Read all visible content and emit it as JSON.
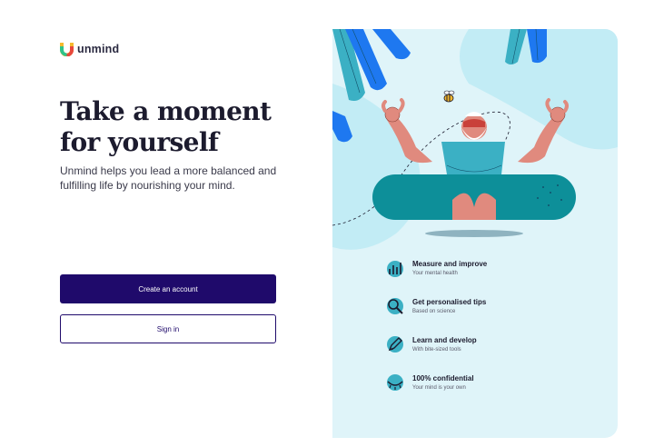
{
  "brand": {
    "name": "unmind"
  },
  "hero": {
    "title_line1": "Take a moment",
    "title_line2": "for yourself",
    "subtitle": "Unmind helps you lead a more balanced and fulfilling life by nourishing your mind."
  },
  "actions": {
    "create_account": "Create an account",
    "sign_in": "Sign in"
  },
  "features": [
    {
      "title": "Measure and improve",
      "subtitle": "Your mental health",
      "icon": "chart-icon"
    },
    {
      "title": "Get personalised tips",
      "subtitle": "Based on science",
      "icon": "magnifier-icon"
    },
    {
      "title": "Learn and develop",
      "subtitle": "With bite-sized tools",
      "icon": "pencil-icon"
    },
    {
      "title": "100% confidential",
      "subtitle": "Your mind is your own",
      "icon": "closed-eye-icon"
    }
  ],
  "colors": {
    "primary": "#1f0a6b",
    "panel_bg": "#dff4f9",
    "teal": "#0d8f99",
    "blue": "#1e78f0",
    "skin": "#e08a7e"
  }
}
